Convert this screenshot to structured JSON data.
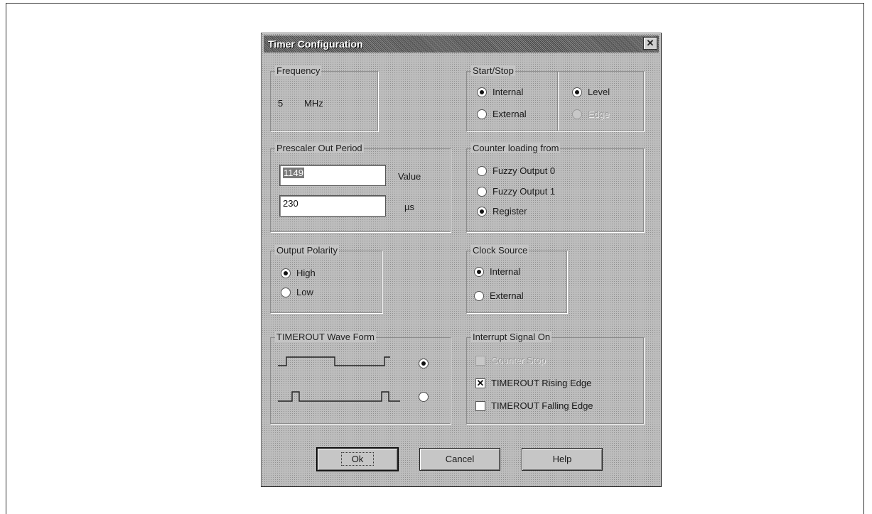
{
  "dialog": {
    "title": "Timer Configuration",
    "close_symbol": "✕"
  },
  "frequency": {
    "legend": "Frequency",
    "value": "5",
    "unit": "MHz"
  },
  "start_stop": {
    "legend": "Start/Stop",
    "internal": "Internal",
    "external": "External",
    "level": "Level",
    "edge": "Edge",
    "source_selected": "Internal",
    "mode_selected": "Level"
  },
  "prescaler": {
    "legend": "Prescaler Out Period",
    "value_input": "1149",
    "value_label": "Value",
    "us_input": "230",
    "us_label": "µs"
  },
  "counter_loading": {
    "legend": "Counter loading from",
    "options": [
      "Fuzzy Output 0",
      "Fuzzy Output 1",
      "Register"
    ],
    "selected": "Register"
  },
  "output_polarity": {
    "legend": "Output Polarity",
    "high": "High",
    "low": "Low",
    "selected": "High"
  },
  "clock_source": {
    "legend": "Clock Source",
    "internal": "Internal",
    "external": "External",
    "selected": "Internal"
  },
  "waveform": {
    "legend": "TIMEROUT Wave Form",
    "selected_index": 0
  },
  "interrupt": {
    "legend": "Interrupt Signal On",
    "counter_stop": "Counter Stop",
    "rising": "TIMEROUT Rising Edge",
    "falling": "TIMEROUT Falling Edge",
    "counter_stop_checked": false,
    "rising_checked": true,
    "falling_checked": false
  },
  "buttons": {
    "ok": "Ok",
    "cancel": "Cancel",
    "help": "Help"
  }
}
